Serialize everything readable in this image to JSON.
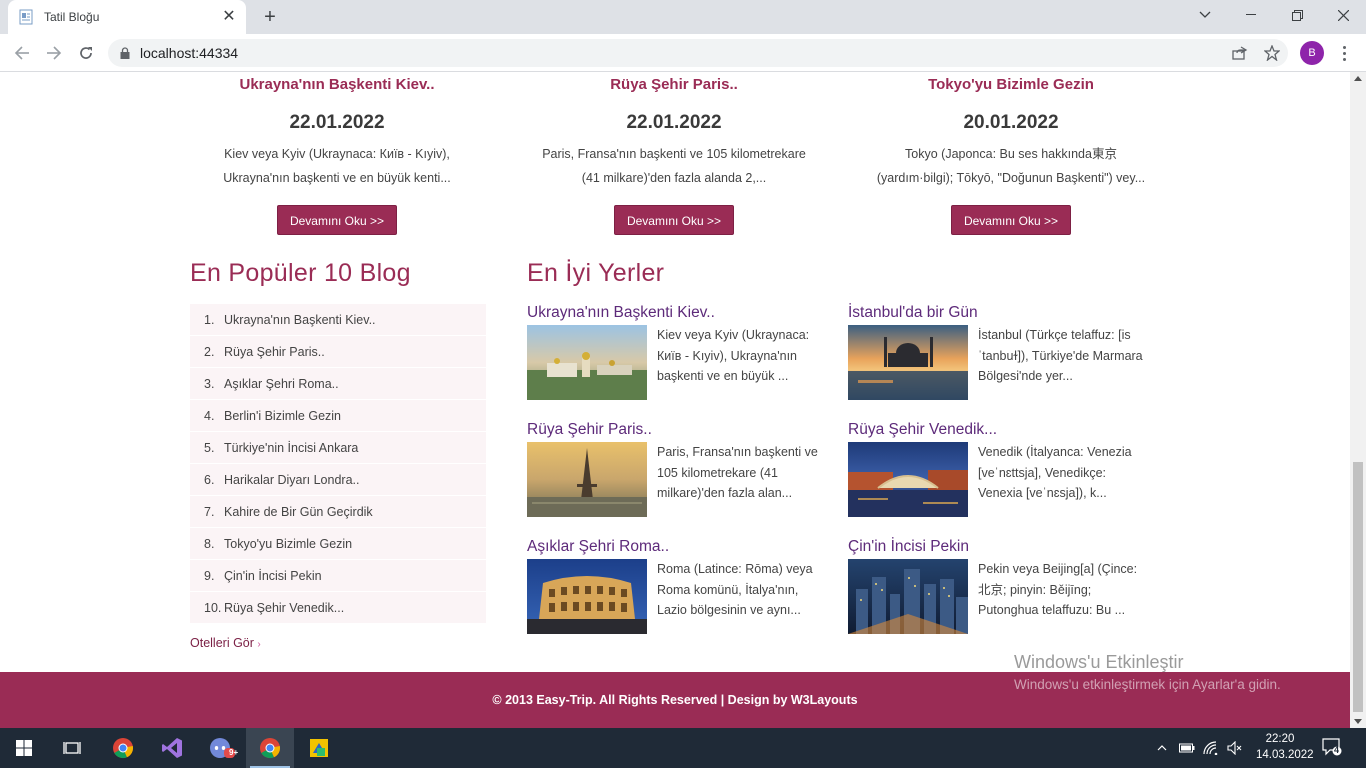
{
  "browser": {
    "tab_title": "Tatil Bloğu",
    "url": "localhost:44334",
    "profile_initial": "B"
  },
  "top_posts": [
    {
      "title": "Ukrayna'nın Başkenti Kiev..",
      "date": "22.01.2022",
      "desc_line1": "Kiev veya Kyiv (Ukraynaca: Київ - Kıyiv),",
      "desc_line2": "Ukrayna'nın başkenti ve en büyük kenti...",
      "button": "Devamını Oku >>"
    },
    {
      "title": "Rüya Şehir Paris..",
      "date": "22.01.2022",
      "desc_line1": "Paris, Fransa'nın başkenti ve 105 kilometrekare",
      "desc_line2": "(41 milkare)'den fazla alanda 2,...",
      "button": "Devamını Oku >>"
    },
    {
      "title": "Tokyo'yu Bizimle Gezin",
      "date": "20.01.2022",
      "desc_line1": "Tokyo (Japonca: Bu ses hakkında東京",
      "desc_line2": "(yardım·bilgi); Tōkyō, \"Doğunun Başkenti\") vey...",
      "button": "Devamını Oku >>"
    }
  ],
  "popular": {
    "heading": "En Popüler 10 Blog",
    "items": [
      {
        "num": "1.",
        "label": "Ukrayna'nın Başkenti Kiev.."
      },
      {
        "num": "2.",
        "label": "Rüya Şehir Paris.."
      },
      {
        "num": "3.",
        "label": "Aşıklar Şehri Roma.."
      },
      {
        "num": "4.",
        "label": "Berlin'i Bizimle Gezin"
      },
      {
        "num": "5.",
        "label": "Türkiye'nin İncisi Ankara"
      },
      {
        "num": "6.",
        "label": "Harikalar Diyarı Londra.."
      },
      {
        "num": "7.",
        "label": "Kahire de Bir Gün Geçirdik"
      },
      {
        "num": "8.",
        "label": "Tokyo'yu Bizimle Gezin"
      },
      {
        "num": "9.",
        "label": "Çin'in İncisi Pekin"
      },
      {
        "num": "10.",
        "label": "Rüya Şehir Venedik..."
      }
    ],
    "hotels_link": "Otelleri Gör"
  },
  "best_places": {
    "heading": "En İyi Yerler",
    "items": [
      {
        "title": "Ukrayna'nın Başkenti Kiev..",
        "desc": "Kiev veya Kyiv (Ukraynaca: Київ - Kıyiv), Ukrayna'nın başkenti ve en büyük ..."
      },
      {
        "title": "İstanbul'da bir Gün",
        "desc": "İstanbul (Türkçe telaffuz: [is ˈtanbuɫ]), Türkiye'de Marmara Bölgesi'nde yer..."
      },
      {
        "title": "Rüya Şehir Paris..",
        "desc": "Paris, Fransa'nın başkenti ve 105 kilometrekare (41 milkare)'den fazla alan..."
      },
      {
        "title": "Rüya Şehir Venedik...",
        "desc": "Venedik (İtalyanca: Venezia [veˈnɛttsja], Venedikçe: Venexia [veˈnɛsja]), k..."
      },
      {
        "title": "Aşıklar Şehri Roma..",
        "desc": "Roma (Latince: Rōma) veya Roma komünü, İtalya'nın, Lazio bölgesinin ve aynı..."
      },
      {
        "title": "Çin'in İncisi Pekin",
        "desc": "Pekin veya Beijing[a] (Çince: 北京; pinyin: Běijīng; Putonghua telaffuzu: Bu ..."
      }
    ]
  },
  "footer": {
    "text": "© 2013 Easy-Trip. All Rights Reserved | Design by W3Layouts"
  },
  "watermark": {
    "line1": "Windows'u Etkinleştir",
    "line2": "Windows'u etkinleştirmek için Ayarlar'a gidin."
  },
  "taskbar": {
    "time": "22:20",
    "date": "14.03.2022",
    "notif_count": "4",
    "badge": "9+"
  },
  "colors": {
    "accent": "#9a2c55",
    "title_purple": "#5d2a7a"
  }
}
